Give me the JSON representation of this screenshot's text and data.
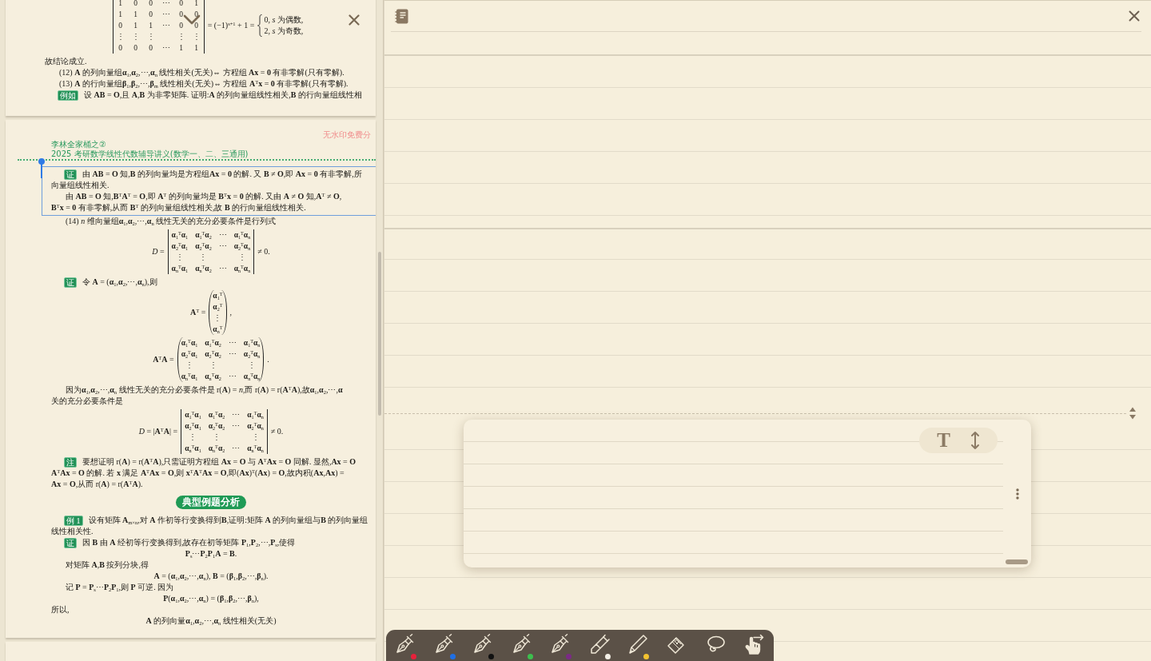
{
  "reader": {
    "pages": [
      {
        "blocks": [
          {
            "kind": "equation",
            "parts": [
              {
                "kind": "determinant",
                "rows": [
                  [
                    "1",
                    "0",
                    "0",
                    "⋯",
                    "0",
                    "1"
                  ],
                  [
                    "1",
                    "1",
                    "0",
                    "⋯",
                    "0",
                    "0"
                  ],
                  [
                    "0",
                    "1",
                    "1",
                    "⋯",
                    "0",
                    "0"
                  ],
                  [
                    "⋮",
                    "⋮",
                    "⋮",
                    null,
                    "⋮",
                    "⋮"
                  ],
                  [
                    "0",
                    "0",
                    "0",
                    "⋯",
                    "1",
                    "1"
                  ]
                ]
              },
              {
                "kind": "text",
                "text": "= (−1)$^{s+1}$ + 1 ="
              },
              {
                "kind": "cases",
                "rows": [
                  "0, *s* 为偶数,",
                  "2, *s* 为奇数,"
                ]
              }
            ]
          },
          {
            "kind": "line",
            "text": "故结论成立."
          },
          {
            "kind": "para",
            "text": "(12) **A** 的列向量组**α**$_{1}$,**α**$_{2}$,⋯,**α**$_{n}$ 线性相关(无关)⇔ 方程组 **Ax** = **0** 有非零解(只有零解)."
          },
          {
            "kind": "para",
            "text": "(13) **A** 的行向量组**β**$_{1}$,**β**$_{2}$,⋯,**β**$_{m}$ 线性相关(无关)⇔ 方程组 **A**$^{T}$**x** = **0** 有非零解(只有零解)."
          },
          {
            "kind": "badged",
            "badge": "例如",
            "text": "设 **AB** = **O**,且 **A**,**B** 为非零矩阵. 证明:**A** 的列向量组线性相关,**B** 的行向量组线性相"
          }
        ]
      },
      {
        "header": {
          "notice": "无水印免费分",
          "series": "李林全家桶之②",
          "title": "2025 考研数学线性代数辅导讲义(数学一、二、三通用)"
        },
        "blocks": [
          {
            "kind": "selection",
            "selected": true,
            "blocks": [
              {
                "kind": "badged",
                "badge": "证",
                "text": "由 **AB** = **O** 知,**B** 的列向量均是方程组**Ax** = **0** 的解. 又 **B** ≠ **O**,即 **Ax** = **0** 有非零解,所"
              },
              {
                "kind": "line",
                "text": "向量组线性相关."
              },
              {
                "kind": "para",
                "text": "由 **AB** = **O** 知,**B**$^{T}$**A**$^{T}$ = **O**,即 **A**$^{T}$ 的列向量均是 **B**$^{T}$**x** = **0** 的解. 又由 **A** ≠ **O** 知,**A**$^{T}$ ≠ **O**,"
              },
              {
                "kind": "line",
                "text": "**B**$^{T}$**x** = **0** 有非零解,从而 **B**$^{T}$ 的列向量组线性相关,故 **B** 的行向量组线性相关."
              }
            ]
          },
          {
            "kind": "para",
            "text": "(14) *n* 维向量组**α**$_{1}$,**α**$_{2}$,⋯,**α**$_{n}$ 线性无关的充分必要条件是行列式"
          },
          {
            "kind": "equation",
            "parts": [
              {
                "kind": "text",
                "text": "*D* ="
              },
              {
                "kind": "determinant",
                "rows": [
                  [
                    "**α**$_{1}$$^{T}$**α**$_{1}$",
                    "**α**$_{1}$$^{T}$**α**$_{2}$",
                    "⋯",
                    "**α**$_{1}$$^{T}$**α**$_{n}$"
                  ],
                  [
                    "**α**$_{2}$$^{T}$**α**$_{1}$",
                    "**α**$_{2}$$^{T}$**α**$_{2}$",
                    "⋯",
                    "**α**$_{2}$$^{T}$**α**$_{n}$"
                  ],
                  [
                    "⋮",
                    "⋮",
                    null,
                    "⋮"
                  ],
                  [
                    "**α**$_{n}$$^{T}$**α**$_{1}$",
                    "**α**$_{n}$$^{T}$**α**$_{2}$",
                    "⋯",
                    "**α**$_{n}$$^{T}$**α**$_{n}$"
                  ]
                ]
              },
              {
                "kind": "text",
                "text": "≠ 0."
              }
            ]
          },
          {
            "kind": "badged",
            "badge": "证",
            "text": "令 **A** = (**α**$_{1}$,**α**$_{2}$,⋯,**α**$_{n}$),则"
          },
          {
            "kind": "equation",
            "parts": [
              {
                "kind": "text",
                "text": "**A**$^{T}$ ="
              },
              {
                "kind": "matrix",
                "rows": [
                  [
                    "**α**$_{1}$$^{T}$"
                  ],
                  [
                    "**α**$_{2}$$^{T}$"
                  ],
                  [
                    "⋮"
                  ],
                  [
                    "**α**$_{n}$$^{T}$"
                  ]
                ]
              },
              {
                "kind": "text",
                "text": ","
              }
            ]
          },
          {
            "kind": "equation",
            "parts": [
              {
                "kind": "text",
                "text": "**A**$^{T}$**A** ="
              },
              {
                "kind": "matrix",
                "rows": [
                  [
                    "**α**$_{1}$$^{T}$**α**$_{1}$",
                    "**α**$_{1}$$^{T}$**α**$_{2}$",
                    "⋯",
                    "**α**$_{1}$$^{T}$**α**$_{n}$"
                  ],
                  [
                    "**α**$_{2}$$^{T}$**α**$_{1}$",
                    "**α**$_{2}$$^{T}$**α**$_{2}$",
                    "⋯",
                    "**α**$_{2}$$^{T}$**α**$_{n}$"
                  ],
                  [
                    "⋮",
                    "⋮",
                    null,
                    "⋮"
                  ],
                  [
                    "**α**$_{n}$$^{T}$**α**$_{1}$",
                    "**α**$_{n}$$^{T}$**α**$_{2}$",
                    "⋯",
                    "**α**$_{n}$$^{T}$**α**$_{n}$"
                  ]
                ]
              },
              {
                "kind": "text",
                "text": "."
              }
            ]
          },
          {
            "kind": "para",
            "text": "因为**α**$_{1}$,**α**$_{2}$,⋯,**α**$_{n}$ 线性无关的充分必要条件是 r(**A**) = *n*,而 r(**A**) = r(**A**$^{T}$**A**),故**α**$_{1}$,**α**$_{2}$,⋯,**α**"
          },
          {
            "kind": "line",
            "text": "关的充分必要条件是"
          },
          {
            "kind": "equation",
            "parts": [
              {
                "kind": "text",
                "text": "*D* = |**A**$^{T}$**A**| ="
              },
              {
                "kind": "determinant",
                "rows": [
                  [
                    "**α**$_{1}$$^{T}$**α**$_{1}$",
                    "**α**$_{1}$$^{T}$**α**$_{2}$",
                    "⋯",
                    "**α**$_{1}$$^{T}$**α**$_{n}$"
                  ],
                  [
                    "**α**$_{2}$$^{T}$**α**$_{1}$",
                    "**α**$_{2}$$^{T}$**α**$_{2}$",
                    "⋯",
                    "**α**$_{2}$$^{T}$**α**$_{n}$"
                  ],
                  [
                    "⋮",
                    "⋮",
                    null,
                    "⋮"
                  ],
                  [
                    "**α**$_{n}$$^{T}$**α**$_{1}$",
                    "**α**$_{n}$$^{T}$**α**$_{2}$",
                    "⋯",
                    "**α**$_{n}$$^{T}$**α**$_{n}$"
                  ]
                ]
              },
              {
                "kind": "text",
                "text": "≠ 0."
              }
            ]
          },
          {
            "kind": "badged",
            "badge": "注",
            "text": "要想证明 r(**A**) = r(**A**$^{T}$**A**),只需证明方程组 **Ax** = **O** 与 **A**$^{T}$**Ax** = **O** 同解. 显然,**Ax** = **O**"
          },
          {
            "kind": "line",
            "text": "**A**$^{T}$**Ax** = **O** 的解. 若 **x** 满足 **A**$^{T}$**Ax** = **O**,则 **x**$^{T}$**A**$^{T}$**Ax** = **O**,即(**Ax**)$^{T}$(**Ax**) = **O**,故内积(**Ax**,**Ax**) ="
          },
          {
            "kind": "line",
            "text": "**Ax** = **O**,从而 r(**A**) = r(**A**$^{T}$**A**)."
          },
          {
            "kind": "heading",
            "text": "典型例题分析"
          },
          {
            "kind": "badged",
            "badge": "例 1",
            "text": "设有矩阵 **A**$_{m×n}$,对 **A** 作初等行变换得到**B**,证明:矩阵 **A** 的列向量组与**B** 的列向量组"
          },
          {
            "kind": "line",
            "text": "线性相关性."
          },
          {
            "kind": "badged",
            "badge": "证",
            "text": "因 **B** 由 **A** 经初等行变换得到,故存在初等矩阵 **P**$_{1}$,**P**$_{2}$,⋯,**P**$_{s}$,使得"
          },
          {
            "kind": "center",
            "text": "**P**$_{s}$⋯**P**$_{2}$**P**$_{1}$**A** = **B**."
          },
          {
            "kind": "para",
            "text": "对矩阵 **A**,**B** 按列分块,得"
          },
          {
            "kind": "center",
            "text": "**A** = (**α**$_{1}$,**α**$_{2}$,⋯,**α**$_{n}$),   **B** = (**β**$_{1}$,**β**$_{2}$,⋯,**β**$_{n}$)."
          },
          {
            "kind": "para",
            "text": "记 **P** = **P**$_{s}$⋯**P**$_{2}$**P**$_{1}$,则 **P** 可逆. 因为"
          },
          {
            "kind": "center",
            "text": "**P**(**α**$_{1}$,**α**$_{2}$,⋯,**α**$_{n}$) = (**β**$_{1}$,**β**$_{2}$,⋯,**β**$_{n}$),"
          },
          {
            "kind": "line",
            "text": "所以,"
          },
          {
            "kind": "center",
            "text": "**A** 的列向量**α**$_{1}$,**α**$_{2}$,⋯,**α**$_{n}$ 线性相关(无关)"
          }
        ]
      }
    ]
  },
  "notes": {
    "text_card": {
      "style_button": "T"
    }
  },
  "pen_toolbar": {
    "tools": [
      {
        "kind": "pen",
        "color": "#e8213b",
        "selected": false
      },
      {
        "kind": "pen",
        "color": "#1f6fe5",
        "selected": false
      },
      {
        "kind": "pen",
        "color": "#111111",
        "selected": false
      },
      {
        "kind": "pen",
        "color": "#3dbf4e",
        "selected": false
      },
      {
        "kind": "pen",
        "color": "#7b2a86",
        "selected": false
      },
      {
        "kind": "highlighter",
        "color": "#f3efe6",
        "selected": false
      },
      {
        "kind": "pencil",
        "color": "#f2c230",
        "selected": false
      },
      {
        "kind": "eraser",
        "selected": false
      },
      {
        "kind": "lasso",
        "selected": false
      },
      {
        "kind": "hand",
        "selected": true
      }
    ]
  }
}
